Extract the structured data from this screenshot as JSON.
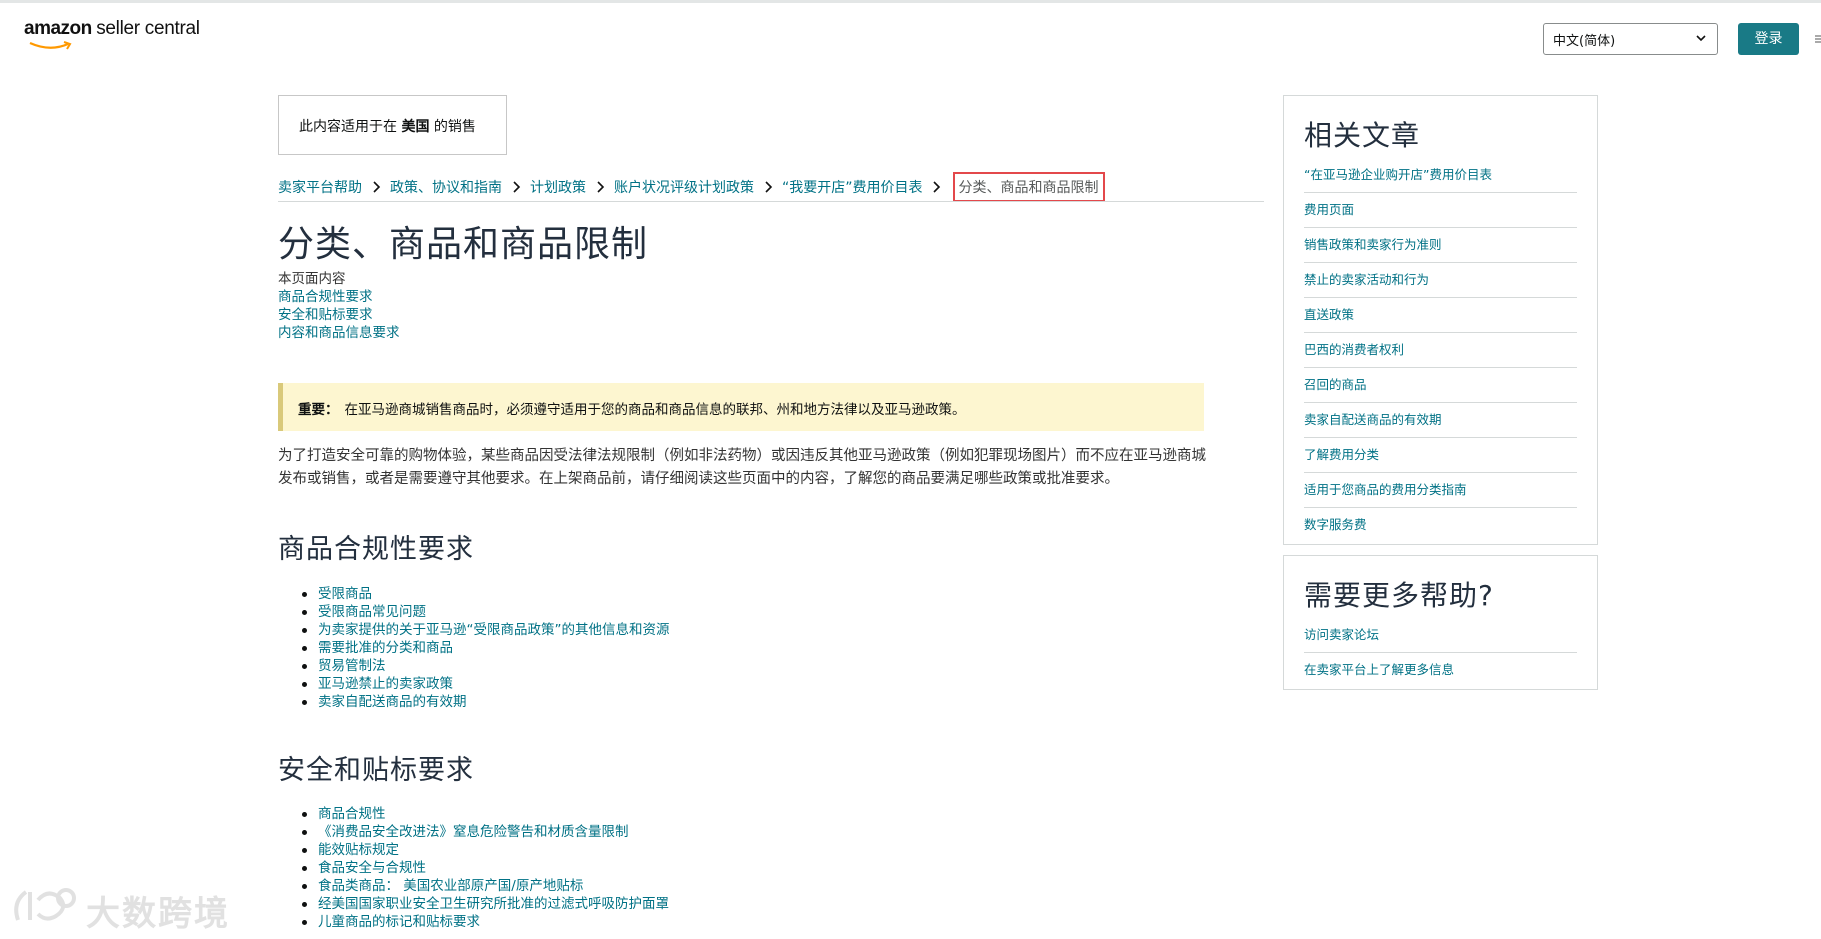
{
  "header": {
    "logo_word1": "amazon",
    "logo_word2": "seller central",
    "language_selected": "中文(简体)",
    "login_label": "登录"
  },
  "scope_notice": {
    "prefix": "此内容适用于在",
    "country": "美国",
    "suffix": "的销售"
  },
  "breadcrumb": [
    "卖家平台帮助",
    "政策、协议和指南",
    "计划政策",
    "账户状况评级计划政策",
    "“我要开店”费用价目表",
    "分类、商品和商品限制"
  ],
  "page": {
    "title": "分类、商品和商品限制",
    "toc_label": "本页面内容",
    "toc": [
      "商品合规性要求",
      "安全和贴标要求",
      "内容和商品信息要求"
    ],
    "alert_label": "重要：",
    "alert_text": "在亚马逊商城销售商品时，必须遵守适用于您的商品和商品信息的联邦、州和地方法律以及亚马逊政策。",
    "intro": "为了打造安全可靠的购物体验，某些商品因受法律法规限制（例如非法药物）或因违反其他亚马逊政策（例如犯罪现场图片）而不应在亚马逊商城发布或销售，或者是需要遵守其他要求。在上架商品前，请仔细阅读这些页面中的内容，了解您的商品要满足哪些政策或批准要求。"
  },
  "sections": [
    {
      "heading": "商品合规性要求",
      "items": [
        "受限商品",
        "受限商品常见问题",
        "为卖家提供的关于亚马逊“受限商品政策”的其他信息和资源",
        "需要批准的分类和商品",
        "贸易管制法",
        "亚马逊禁止的卖家政策",
        "卖家自配送商品的有效期"
      ]
    },
    {
      "heading": "安全和贴标要求",
      "items": [
        "商品合规性",
        "《消费品安全改进法》窒息危险警告和材质含量限制",
        "能效贴标规定",
        "食品安全与合规性",
        "食品类商品： 美国农业部原产国/原产地贴标",
        "经美国国家职业安全卫生研究所批准的过滤式呼吸防护面罩",
        "儿童商品的标记和贴标要求"
      ]
    }
  ],
  "sidebar": {
    "related_heading": "相关文章",
    "related": [
      "“在亚马逊企业购开店”费用价目表",
      "费用页面",
      "销售政策和卖家行为准则",
      "禁止的卖家活动和行为",
      "直送政策",
      "巴西的消费者权利",
      "召回的商品",
      "卖家自配送商品的有效期",
      "了解费用分类",
      "适用于您商品的费用分类指南",
      "数字服务费"
    ],
    "help_heading": "需要更多帮助?",
    "help": [
      "访问卖家论坛",
      "在卖家平台上了解更多信息"
    ]
  },
  "watermark_text": "大数跨境"
}
